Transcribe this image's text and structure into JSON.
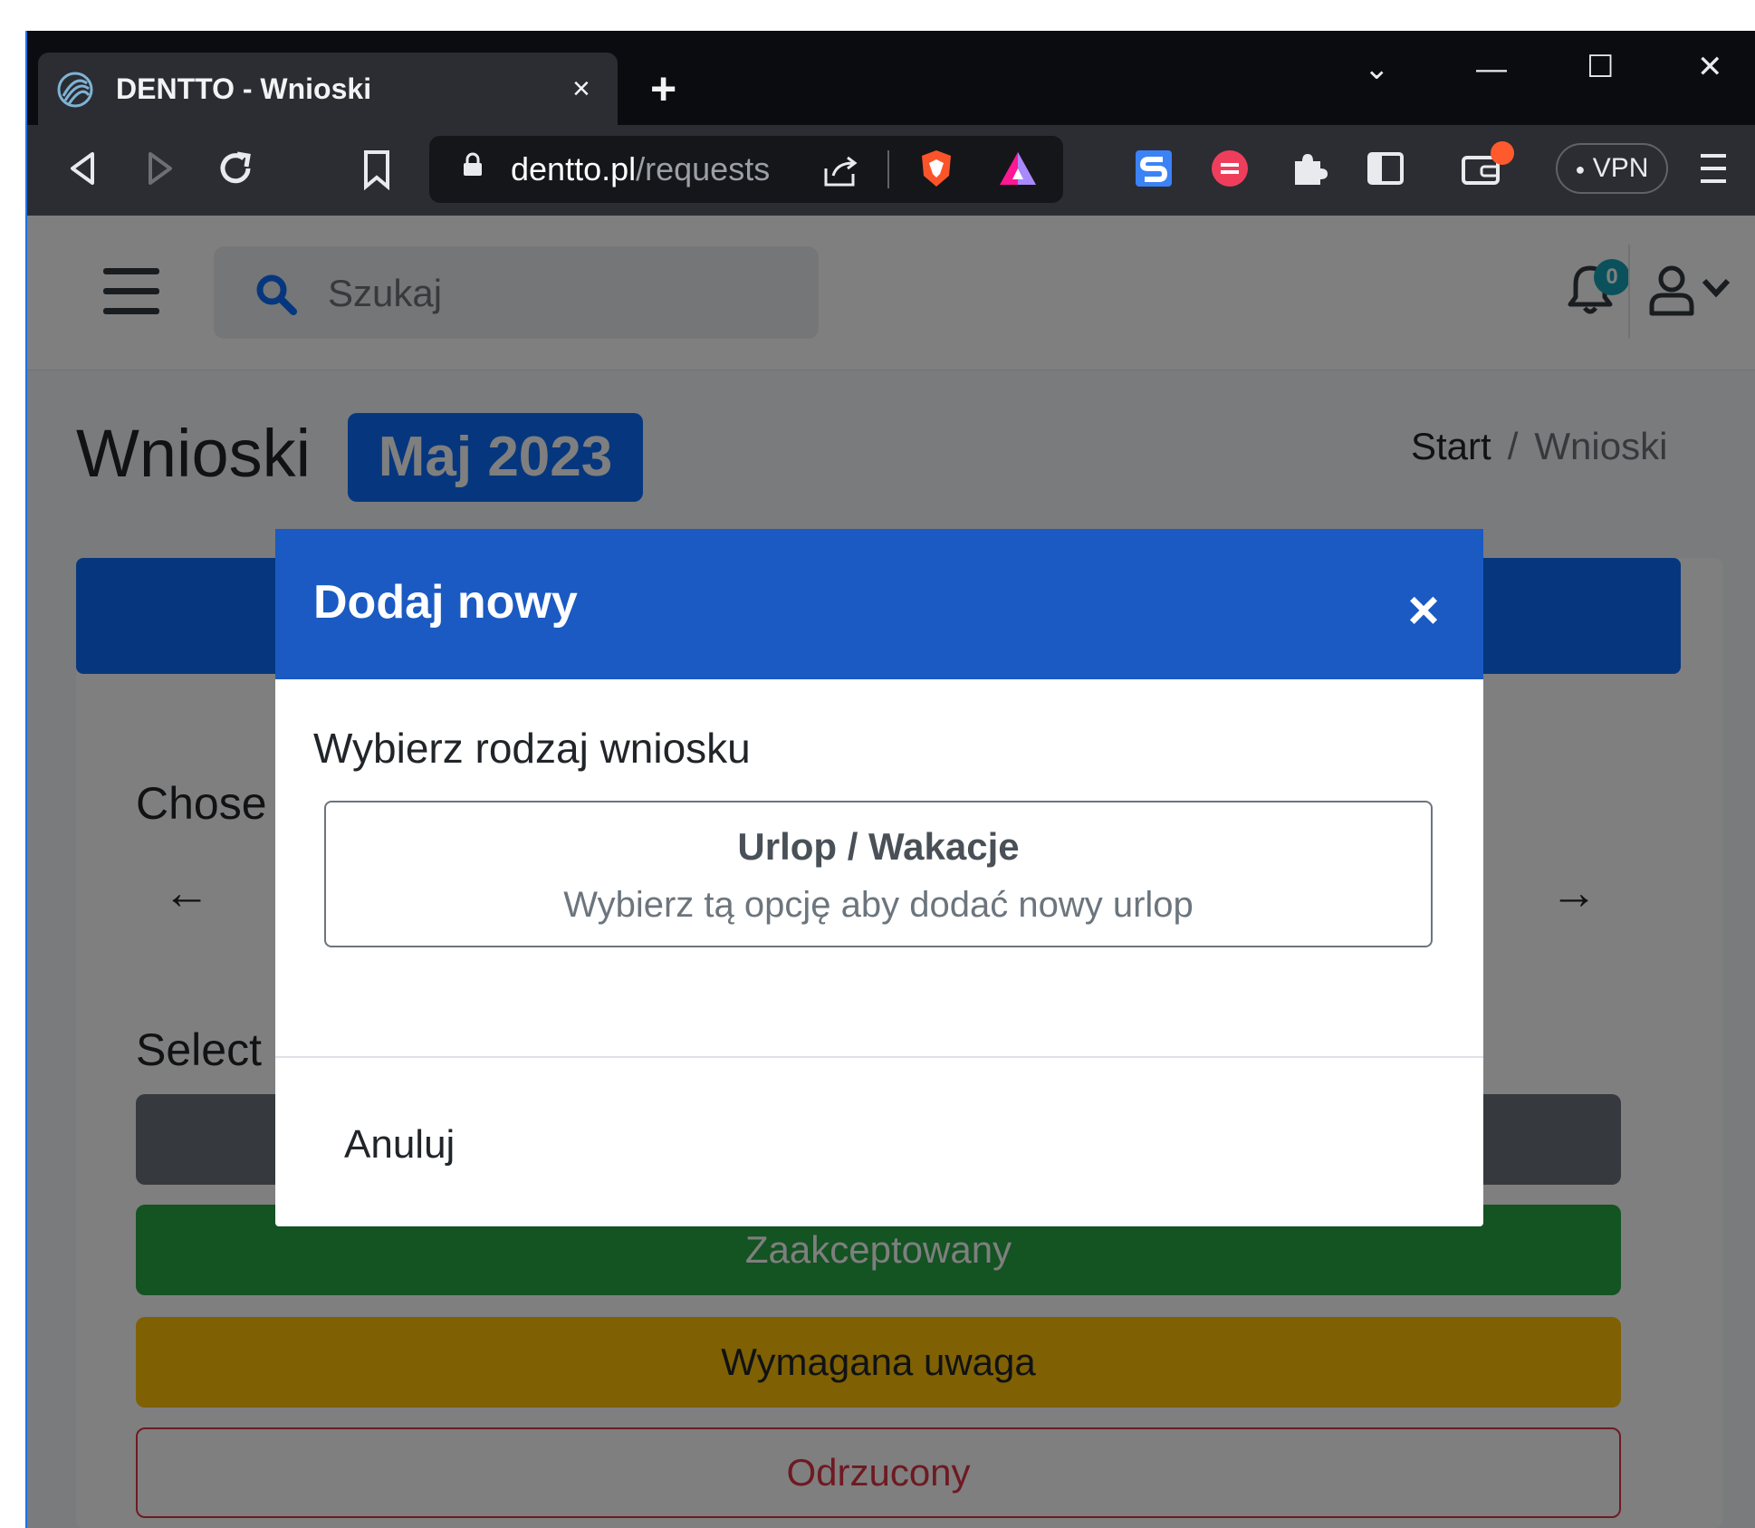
{
  "browser": {
    "tab_title": "DENTTO - Wnioski",
    "tab_close": "×",
    "new_tab": "+",
    "url_domain": "dentto.pl",
    "url_path": "/requests",
    "vpn_label": "VPN",
    "window_controls": {
      "minimize": "—",
      "maximize": "☐",
      "close": "✕",
      "tab_search": "⌄"
    }
  },
  "navbar": {
    "search_placeholder": "Szukaj",
    "notifications_count": "0"
  },
  "header": {
    "title": "Wnioski",
    "month": "Maj 2023",
    "breadcrumb": {
      "home": "Start",
      "separator": "/",
      "current": "Wnioski"
    }
  },
  "content": {
    "chosen_label": "Chose",
    "select_label": "Select",
    "prev_arrow": "←",
    "next_arrow": "→",
    "statuses": [
      "Zaakceptowany",
      "Wymagana uwaga",
      "Odrzucony"
    ]
  },
  "modal": {
    "title": "Dodaj nowy",
    "close": "×",
    "label": "Wybierz rodzaj wniosku",
    "option_title": "Urlop / Wakacje",
    "option_desc": "Wybierz tą opcję aby dodać nowy urlop",
    "cancel": "Anuluj"
  },
  "colors": {
    "primary": "#0d6efd",
    "modal_header": "#1a5ac2",
    "success": "#28a745",
    "warning": "#ffc107",
    "danger": "#dc3545",
    "secondary": "#6c757d"
  }
}
